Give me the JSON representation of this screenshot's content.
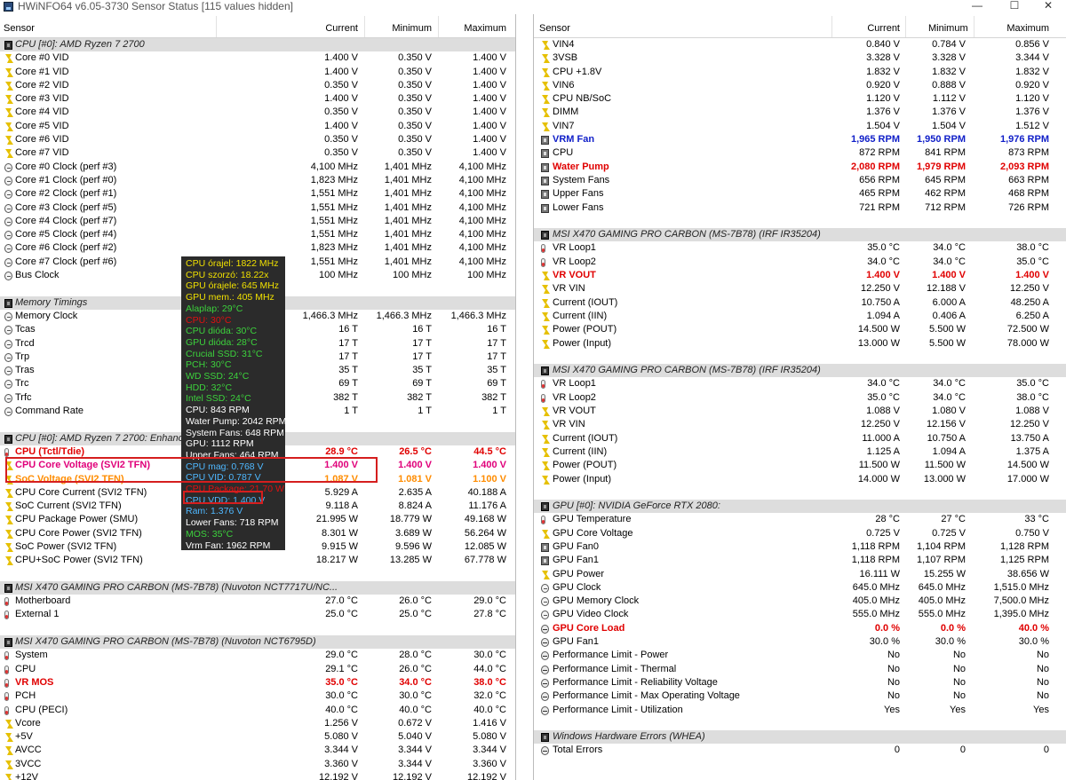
{
  "window": {
    "title": "HWiNFO64 v6.05-3730 Sensor Status [115 values hidden]",
    "minimize": "—",
    "maximize": "☐",
    "close": "✕"
  },
  "columns": {
    "sensor": "Sensor",
    "current": "Current",
    "minimum": "Minimum",
    "maximum": "Maximum"
  },
  "colors": {
    "highlight_red": "#e00000",
    "highlight_blue": "#0f1ec8",
    "group_bg": "#dddddd",
    "overlay_bg": "#2b2b2b",
    "annotation_box": "#d51e1e"
  },
  "left": [
    {
      "t": "g",
      "name": "CPU [#0]: AMD Ryzen 7 2700",
      "icon": "chip"
    },
    {
      "t": "r",
      "icon": "bolt",
      "name": "Core #0 VID",
      "cur": "1.400 V",
      "min": "0.350 V",
      "max": "1.400 V"
    },
    {
      "t": "r",
      "icon": "bolt",
      "name": "Core #1 VID",
      "cur": "1.400 V",
      "min": "0.350 V",
      "max": "1.400 V"
    },
    {
      "t": "r",
      "icon": "bolt",
      "name": "Core #2 VID",
      "cur": "0.350 V",
      "min": "0.350 V",
      "max": "1.400 V"
    },
    {
      "t": "r",
      "icon": "bolt",
      "name": "Core #3 VID",
      "cur": "1.400 V",
      "min": "0.350 V",
      "max": "1.400 V"
    },
    {
      "t": "r",
      "icon": "bolt",
      "name": "Core #4 VID",
      "cur": "0.350 V",
      "min": "0.350 V",
      "max": "1.400 V"
    },
    {
      "t": "r",
      "icon": "bolt",
      "name": "Core #5 VID",
      "cur": "1.400 V",
      "min": "0.350 V",
      "max": "1.400 V"
    },
    {
      "t": "r",
      "icon": "bolt",
      "name": "Core #6 VID",
      "cur": "0.350 V",
      "min": "0.350 V",
      "max": "1.400 V"
    },
    {
      "t": "r",
      "icon": "bolt",
      "name": "Core #7 VID",
      "cur": "0.350 V",
      "min": "0.350 V",
      "max": "1.400 V"
    },
    {
      "t": "r",
      "icon": "clock",
      "name": "Core #0 Clock (perf #3)",
      "cur": "4,100 MHz",
      "min": "1,401 MHz",
      "max": "4,100 MHz"
    },
    {
      "t": "r",
      "icon": "clock",
      "name": "Core #1 Clock (perf #0)",
      "cur": "1,823 MHz",
      "min": "1,401 MHz",
      "max": "4,100 MHz"
    },
    {
      "t": "r",
      "icon": "clock",
      "name": "Core #2 Clock (perf #1)",
      "cur": "1,551 MHz",
      "min": "1,401 MHz",
      "max": "4,100 MHz"
    },
    {
      "t": "r",
      "icon": "clock",
      "name": "Core #3 Clock (perf #5)",
      "cur": "1,551 MHz",
      "min": "1,401 MHz",
      "max": "4,100 MHz"
    },
    {
      "t": "r",
      "icon": "clock",
      "name": "Core #4 Clock (perf #7)",
      "cur": "1,551 MHz",
      "min": "1,401 MHz",
      "max": "4,100 MHz"
    },
    {
      "t": "r",
      "icon": "clock",
      "name": "Core #5 Clock (perf #4)",
      "cur": "1,551 MHz",
      "min": "1,401 MHz",
      "max": "4,100 MHz"
    },
    {
      "t": "r",
      "icon": "clock",
      "name": "Core #6 Clock (perf #2)",
      "cur": "1,823 MHz",
      "min": "1,401 MHz",
      "max": "4,100 MHz"
    },
    {
      "t": "r",
      "icon": "clock",
      "name": "Core #7 Clock (perf #6)",
      "cur": "1,551 MHz",
      "min": "1,401 MHz",
      "max": "4,100 MHz"
    },
    {
      "t": "r",
      "icon": "clock",
      "name": "Bus Clock",
      "cur": "100 MHz",
      "min": "100 MHz",
      "max": "100 MHz"
    },
    {
      "t": "b"
    },
    {
      "t": "g",
      "name": "Memory Timings",
      "icon": "chip"
    },
    {
      "t": "r",
      "icon": "clock",
      "name": "Memory Clock",
      "cur": "1,466.3 MHz",
      "min": "1,466.3 MHz",
      "max": "1,466.3 MHz"
    },
    {
      "t": "r",
      "icon": "clock",
      "name": "Tcas",
      "cur": "16 T",
      "min": "16 T",
      "max": "16 T"
    },
    {
      "t": "r",
      "icon": "clock",
      "name": "Trcd",
      "cur": "17 T",
      "min": "17 T",
      "max": "17 T"
    },
    {
      "t": "r",
      "icon": "clock",
      "name": "Trp",
      "cur": "17 T",
      "min": "17 T",
      "max": "17 T"
    },
    {
      "t": "r",
      "icon": "clock",
      "name": "Tras",
      "cur": "35 T",
      "min": "35 T",
      "max": "35 T"
    },
    {
      "t": "r",
      "icon": "clock",
      "name": "Trc",
      "cur": "69 T",
      "min": "69 T",
      "max": "69 T"
    },
    {
      "t": "r",
      "icon": "clock",
      "name": "Trfc",
      "cur": "382 T",
      "min": "382 T",
      "max": "382 T"
    },
    {
      "t": "r",
      "icon": "clock",
      "name": "Command Rate",
      "cur": "1 T",
      "min": "1 T",
      "max": "1 T"
    },
    {
      "t": "b"
    },
    {
      "t": "g",
      "name": "CPU [#0]: AMD Ryzen 7 2700: Enhanced",
      "icon": "chip"
    },
    {
      "t": "r",
      "icon": "therm",
      "name": "CPU (Tctl/Tdie)",
      "cur": "28.9 °C",
      "min": "26.5 °C",
      "max": "44.5 °C",
      "style": "red"
    },
    {
      "t": "r",
      "icon": "bolt",
      "name": "CPU Core Voltage (SVI2 TFN)",
      "cur": "1.400 V",
      "min": "1.400 V",
      "max": "1.400 V",
      "style": "magenta"
    },
    {
      "t": "r",
      "icon": "bolt",
      "name": "SoC Voltage (SVI2 TFN)",
      "cur": "1.087 V",
      "min": "1.081 V",
      "max": "1.100 V",
      "style": "orange"
    },
    {
      "t": "r",
      "icon": "bolt",
      "name": "CPU Core Current (SVI2 TFN)",
      "cur": "5.929 A",
      "min": "2.635 A",
      "max": "40.188 A"
    },
    {
      "t": "r",
      "icon": "bolt",
      "name": "SoC Current (SVI2 TFN)",
      "cur": "9.118 A",
      "min": "8.824 A",
      "max": "11.176 A"
    },
    {
      "t": "r",
      "icon": "bolt",
      "name": "CPU Package Power (SMU)",
      "cur": "21.995 W",
      "min": "18.779 W",
      "max": "49.168 W"
    },
    {
      "t": "r",
      "icon": "bolt",
      "name": "CPU Core Power (SVI2 TFN)",
      "cur": "8.301 W",
      "min": "3.689 W",
      "max": "56.264 W"
    },
    {
      "t": "r",
      "icon": "bolt",
      "name": "SoC Power (SVI2 TFN)",
      "cur": "9.915 W",
      "min": "9.596 W",
      "max": "12.085 W"
    },
    {
      "t": "r",
      "icon": "bolt",
      "name": "CPU+SoC Power (SVI2 TFN)",
      "cur": "18.217 W",
      "min": "13.285 W",
      "max": "67.778 W"
    },
    {
      "t": "b"
    },
    {
      "t": "g",
      "name": "MSI X470 GAMING PRO CARBON (MS-7B78) (Nuvoton NCT7717U/NC...",
      "icon": "chip"
    },
    {
      "t": "r",
      "icon": "therm",
      "name": "Motherboard",
      "cur": "27.0 °C",
      "min": "26.0 °C",
      "max": "29.0 °C"
    },
    {
      "t": "r",
      "icon": "therm",
      "name": "External 1",
      "cur": "25.0 °C",
      "min": "25.0 °C",
      "max": "27.8 °C"
    },
    {
      "t": "b"
    },
    {
      "t": "g",
      "name": "MSI X470 GAMING PRO CARBON (MS-7B78) (Nuvoton NCT6795D)",
      "icon": "chip"
    },
    {
      "t": "r",
      "icon": "therm",
      "name": "System",
      "cur": "29.0 °C",
      "min": "28.0 °C",
      "max": "30.0 °C"
    },
    {
      "t": "r",
      "icon": "therm",
      "name": "CPU",
      "cur": "29.1 °C",
      "min": "26.0 °C",
      "max": "44.0 °C"
    },
    {
      "t": "r",
      "icon": "therm",
      "name": "VR MOS",
      "cur": "35.0 °C",
      "min": "34.0 °C",
      "max": "38.0 °C",
      "style": "red"
    },
    {
      "t": "r",
      "icon": "therm",
      "name": "PCH",
      "cur": "30.0 °C",
      "min": "30.0 °C",
      "max": "32.0 °C"
    },
    {
      "t": "r",
      "icon": "therm",
      "name": "CPU (PECI)",
      "cur": "40.0 °C",
      "min": "40.0 °C",
      "max": "40.0 °C"
    },
    {
      "t": "r",
      "icon": "bolt",
      "name": "Vcore",
      "cur": "1.256 V",
      "min": "0.672 V",
      "max": "1.416 V"
    },
    {
      "t": "r",
      "icon": "bolt",
      "name": "+5V",
      "cur": "5.080 V",
      "min": "5.040 V",
      "max": "5.080 V"
    },
    {
      "t": "r",
      "icon": "bolt",
      "name": "AVCC",
      "cur": "3.344 V",
      "min": "3.344 V",
      "max": "3.344 V"
    },
    {
      "t": "r",
      "icon": "bolt",
      "name": "3VCC",
      "cur": "3.360 V",
      "min": "3.344 V",
      "max": "3.360 V"
    },
    {
      "t": "r",
      "icon": "bolt",
      "name": "+12V",
      "cur": "12.192 V",
      "min": "12.192 V",
      "max": "12.192 V"
    }
  ],
  "right": [
    {
      "t": "r",
      "icon": "bolt",
      "name": "VIN4",
      "cur": "0.840 V",
      "min": "0.784 V",
      "max": "0.856 V"
    },
    {
      "t": "r",
      "icon": "bolt",
      "name": "3VSB",
      "cur": "3.328 V",
      "min": "3.328 V",
      "max": "3.344 V"
    },
    {
      "t": "r",
      "icon": "bolt",
      "name": "CPU +1.8V",
      "cur": "1.832 V",
      "min": "1.832 V",
      "max": "1.832 V"
    },
    {
      "t": "r",
      "icon": "bolt",
      "name": "VIN6",
      "cur": "0.920 V",
      "min": "0.888 V",
      "max": "0.920 V"
    },
    {
      "t": "r",
      "icon": "bolt",
      "name": "CPU NB/SoC",
      "cur": "1.120 V",
      "min": "1.112 V",
      "max": "1.120 V"
    },
    {
      "t": "r",
      "icon": "bolt",
      "name": "DIMM",
      "cur": "1.376 V",
      "min": "1.376 V",
      "max": "1.376 V"
    },
    {
      "t": "r",
      "icon": "bolt",
      "name": "VIN7",
      "cur": "1.504 V",
      "min": "1.504 V",
      "max": "1.512 V"
    },
    {
      "t": "r",
      "icon": "fan",
      "name": "VRM Fan",
      "cur": "1,965 RPM",
      "min": "1,950 RPM",
      "max": "1,976 RPM",
      "style": "blue"
    },
    {
      "t": "r",
      "icon": "fan",
      "name": "CPU",
      "cur": "872 RPM",
      "min": "841 RPM",
      "max": "873 RPM"
    },
    {
      "t": "r",
      "icon": "fan",
      "name": "Water Pump",
      "cur": "2,080 RPM",
      "min": "1,979 RPM",
      "max": "2,093 RPM",
      "style": "red"
    },
    {
      "t": "r",
      "icon": "fan",
      "name": "System Fans",
      "cur": "656 RPM",
      "min": "645 RPM",
      "max": "663 RPM"
    },
    {
      "t": "r",
      "icon": "fan",
      "name": "Upper Fans",
      "cur": "465 RPM",
      "min": "462 RPM",
      "max": "468 RPM"
    },
    {
      "t": "r",
      "icon": "fan",
      "name": "Lower Fans",
      "cur": "721 RPM",
      "min": "712 RPM",
      "max": "726 RPM"
    },
    {
      "t": "b"
    },
    {
      "t": "g",
      "name": "MSI X470 GAMING PRO CARBON (MS-7B78) (IRF IR35204)",
      "icon": "chip"
    },
    {
      "t": "r",
      "icon": "therm",
      "name": "VR Loop1",
      "cur": "35.0 °C",
      "min": "34.0 °C",
      "max": "38.0 °C"
    },
    {
      "t": "r",
      "icon": "therm",
      "name": "VR Loop2",
      "cur": "34.0 °C",
      "min": "34.0 °C",
      "max": "35.0 °C"
    },
    {
      "t": "r",
      "icon": "bolt",
      "name": "VR VOUT",
      "cur": "1.400 V",
      "min": "1.400 V",
      "max": "1.400 V",
      "style": "red"
    },
    {
      "t": "r",
      "icon": "bolt",
      "name": "VR VIN",
      "cur": "12.250 V",
      "min": "12.188 V",
      "max": "12.250 V"
    },
    {
      "t": "r",
      "icon": "bolt",
      "name": "Current (IOUT)",
      "cur": "10.750 A",
      "min": "6.000 A",
      "max": "48.250 A"
    },
    {
      "t": "r",
      "icon": "bolt",
      "name": "Current (IIN)",
      "cur": "1.094 A",
      "min": "0.406 A",
      "max": "6.250 A"
    },
    {
      "t": "r",
      "icon": "bolt",
      "name": "Power (POUT)",
      "cur": "14.500 W",
      "min": "5.500 W",
      "max": "72.500 W"
    },
    {
      "t": "r",
      "icon": "bolt",
      "name": "Power (Input)",
      "cur": "13.000 W",
      "min": "5.500 W",
      "max": "78.000 W"
    },
    {
      "t": "b"
    },
    {
      "t": "g",
      "name": "MSI X470 GAMING PRO CARBON (MS-7B78) (IRF IR35204)",
      "icon": "chip"
    },
    {
      "t": "r",
      "icon": "therm",
      "name": "VR Loop1",
      "cur": "34.0 °C",
      "min": "34.0 °C",
      "max": "35.0 °C"
    },
    {
      "t": "r",
      "icon": "therm",
      "name": "VR Loop2",
      "cur": "35.0 °C",
      "min": "34.0 °C",
      "max": "38.0 °C"
    },
    {
      "t": "r",
      "icon": "bolt",
      "name": "VR VOUT",
      "cur": "1.088 V",
      "min": "1.080 V",
      "max": "1.088 V"
    },
    {
      "t": "r",
      "icon": "bolt",
      "name": "VR VIN",
      "cur": "12.250 V",
      "min": "12.156 V",
      "max": "12.250 V"
    },
    {
      "t": "r",
      "icon": "bolt",
      "name": "Current (IOUT)",
      "cur": "11.000 A",
      "min": "10.750 A",
      "max": "13.750 A"
    },
    {
      "t": "r",
      "icon": "bolt",
      "name": "Current (IIN)",
      "cur": "1.125 A",
      "min": "1.094 A",
      "max": "1.375 A"
    },
    {
      "t": "r",
      "icon": "bolt",
      "name": "Power (POUT)",
      "cur": "11.500 W",
      "min": "11.500 W",
      "max": "14.500 W"
    },
    {
      "t": "r",
      "icon": "bolt",
      "name": "Power (Input)",
      "cur": "14.000 W",
      "min": "13.000 W",
      "max": "17.000 W"
    },
    {
      "t": "b"
    },
    {
      "t": "g",
      "name": "GPU [#0]: NVIDIA GeForce RTX 2080:",
      "icon": "chip"
    },
    {
      "t": "r",
      "icon": "therm",
      "name": "GPU Temperature",
      "cur": "28 °C",
      "min": "27 °C",
      "max": "33 °C"
    },
    {
      "t": "r",
      "icon": "bolt",
      "name": "GPU Core Voltage",
      "cur": "0.725 V",
      "min": "0.725 V",
      "max": "0.750 V"
    },
    {
      "t": "r",
      "icon": "fan",
      "name": "GPU Fan0",
      "cur": "1,118 RPM",
      "min": "1,104 RPM",
      "max": "1,128 RPM"
    },
    {
      "t": "r",
      "icon": "fan",
      "name": "GPU Fan1",
      "cur": "1,118 RPM",
      "min": "1,107 RPM",
      "max": "1,125 RPM"
    },
    {
      "t": "r",
      "icon": "bolt",
      "name": "GPU Power",
      "cur": "16.111 W",
      "min": "15.255 W",
      "max": "38.656 W"
    },
    {
      "t": "r",
      "icon": "clock",
      "name": "GPU Clock",
      "cur": "645.0 MHz",
      "min": "645.0 MHz",
      "max": "1,515.0 MHz"
    },
    {
      "t": "r",
      "icon": "clock",
      "name": "GPU Memory Clock",
      "cur": "405.0 MHz",
      "min": "405.0 MHz",
      "max": "7,500.0 MHz"
    },
    {
      "t": "r",
      "icon": "clock",
      "name": "GPU Video Clock",
      "cur": "555.0 MHz",
      "min": "555.0 MHz",
      "max": "1,395.0 MHz"
    },
    {
      "t": "r",
      "icon": "pct",
      "name": "GPU Core Load",
      "cur": "0.0 %",
      "min": "0.0 %",
      "max": "40.0 %",
      "style": "red"
    },
    {
      "t": "r",
      "icon": "pct",
      "name": "GPU Fan1",
      "cur": "30.0 %",
      "min": "30.0 %",
      "max": "30.0 %"
    },
    {
      "t": "r",
      "icon": "pct",
      "name": "Performance Limit - Power",
      "cur": "No",
      "min": "No",
      "max": "No"
    },
    {
      "t": "r",
      "icon": "pct",
      "name": "Performance Limit - Thermal",
      "cur": "No",
      "min": "No",
      "max": "No"
    },
    {
      "t": "r",
      "icon": "pct",
      "name": "Performance Limit - Reliability Voltage",
      "cur": "No",
      "min": "No",
      "max": "No"
    },
    {
      "t": "r",
      "icon": "pct",
      "name": "Performance Limit - Max Operating Voltage",
      "cur": "No",
      "min": "No",
      "max": "No"
    },
    {
      "t": "r",
      "icon": "pct",
      "name": "Performance Limit - Utilization",
      "cur": "Yes",
      "min": "Yes",
      "max": "Yes"
    },
    {
      "t": "b"
    },
    {
      "t": "g",
      "name": "Windows Hardware Errors (WHEA)",
      "icon": "chip"
    },
    {
      "t": "r",
      "icon": "pct",
      "name": "Total Errors",
      "cur": "0",
      "min": "0",
      "max": "0"
    }
  ],
  "overlay": [
    {
      "text": "CPU órajel: 1822 MHz",
      "color": "#f0e000"
    },
    {
      "text": "CPU szorzó: 18.22x",
      "color": "#f0e000"
    },
    {
      "text": "GPU órajele: 645 MHz",
      "color": "#f0e000"
    },
    {
      "text": "GPU mem.: 405 MHz",
      "color": "#f0e000"
    },
    {
      "text": "Alaplap: 29°C",
      "color": "#3cd23c"
    },
    {
      "text": "CPU: 30°C",
      "color": "#e01010"
    },
    {
      "text": "CPU dióda: 30°C",
      "color": "#3cd23c"
    },
    {
      "text": "GPU dióda: 28°C",
      "color": "#3cd23c"
    },
    {
      "text": "Crucial SSD: 31°C",
      "color": "#3cd23c"
    },
    {
      "text": "PCH: 30°C",
      "color": "#3cd23c"
    },
    {
      "text": "WD SSD: 24°C",
      "color": "#3cd23c"
    },
    {
      "text": "HDD: 32°C",
      "color": "#3cd23c"
    },
    {
      "text": "Intel SSD: 24°C",
      "color": "#3cd23c"
    },
    {
      "text": "CPU: 843 RPM",
      "color": "#ffffff"
    },
    {
      "text": "Water Pump: 2042 RPM",
      "color": "#ffffff"
    },
    {
      "text": "System Fans: 648 RPM",
      "color": "#ffffff"
    },
    {
      "text": "GPU: 1112 RPM",
      "color": "#ffffff"
    },
    {
      "text": "Upper Fans: 464 RPM",
      "color": "#ffffff"
    },
    {
      "text": "CPU mag: 0.768 V",
      "color": "#4fb8ff"
    },
    {
      "text": "CPU VID: 0.787 V",
      "color": "#4fb8ff"
    },
    {
      "text": "CPU Package: 21.70 W",
      "color": "#e01010"
    },
    {
      "text": "CPU VDD: 1.400 V",
      "color": "#4fb8ff"
    },
    {
      "text": "Ram: 1.376 V",
      "color": "#4fb8ff"
    },
    {
      "text": "Lower Fans: 718 RPM",
      "color": "#ffffff"
    },
    {
      "text": "MOS: 35°C",
      "color": "#3cd23c"
    },
    {
      "text": "Vrm Fan: 1962 RPM",
      "color": "#ffffff"
    }
  ]
}
